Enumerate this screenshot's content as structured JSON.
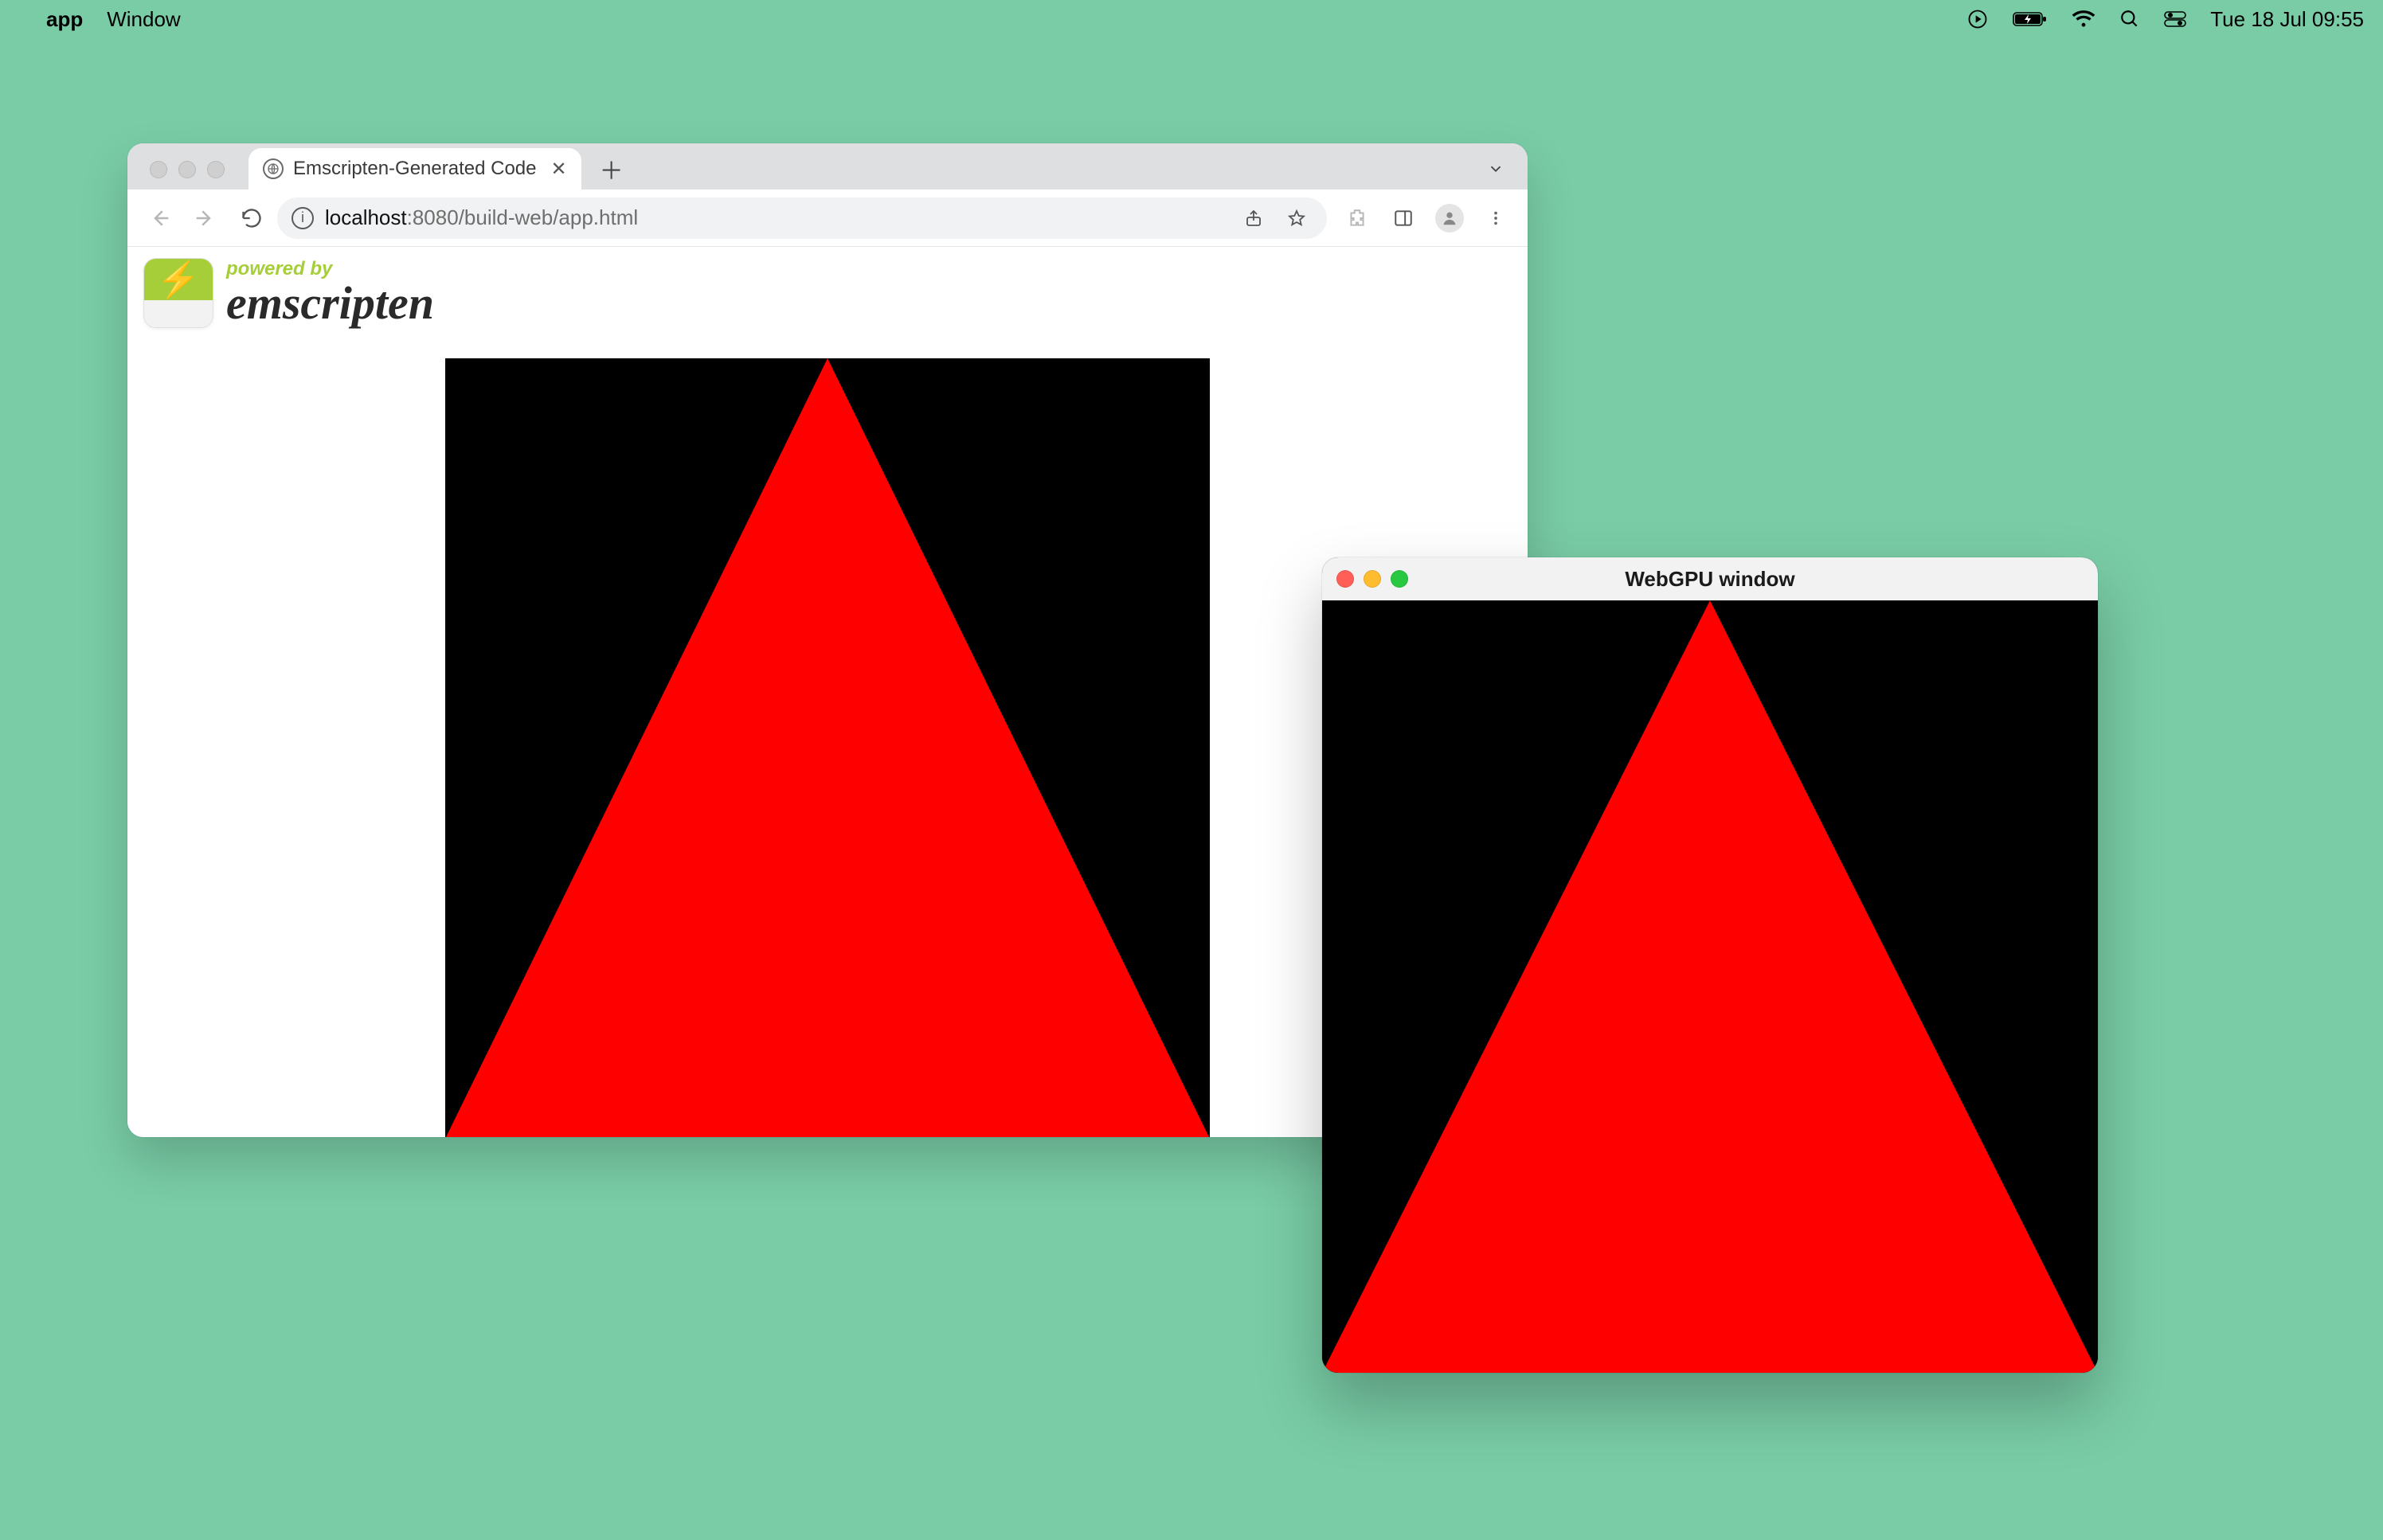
{
  "menubar": {
    "app_name": "app",
    "menus": [
      "Window"
    ],
    "clock": "Tue 18 Jul  09:55",
    "icons": [
      "play-circle-icon",
      "battery-charging-icon",
      "wifi-icon",
      "search-icon",
      "control-center-icon"
    ]
  },
  "browser": {
    "tab_title": "Emscripten-Generated Code",
    "url_host": "localhost",
    "url_rest": ":8080/build-web/app.html",
    "banner_powered": "powered by",
    "banner_name": "emscripten",
    "canvas": {
      "bg": "#000000",
      "triangle_color": "#ff0000"
    }
  },
  "native_window": {
    "title": "WebGPU window",
    "canvas": {
      "bg": "#000000",
      "triangle_color": "#ff0000"
    }
  }
}
